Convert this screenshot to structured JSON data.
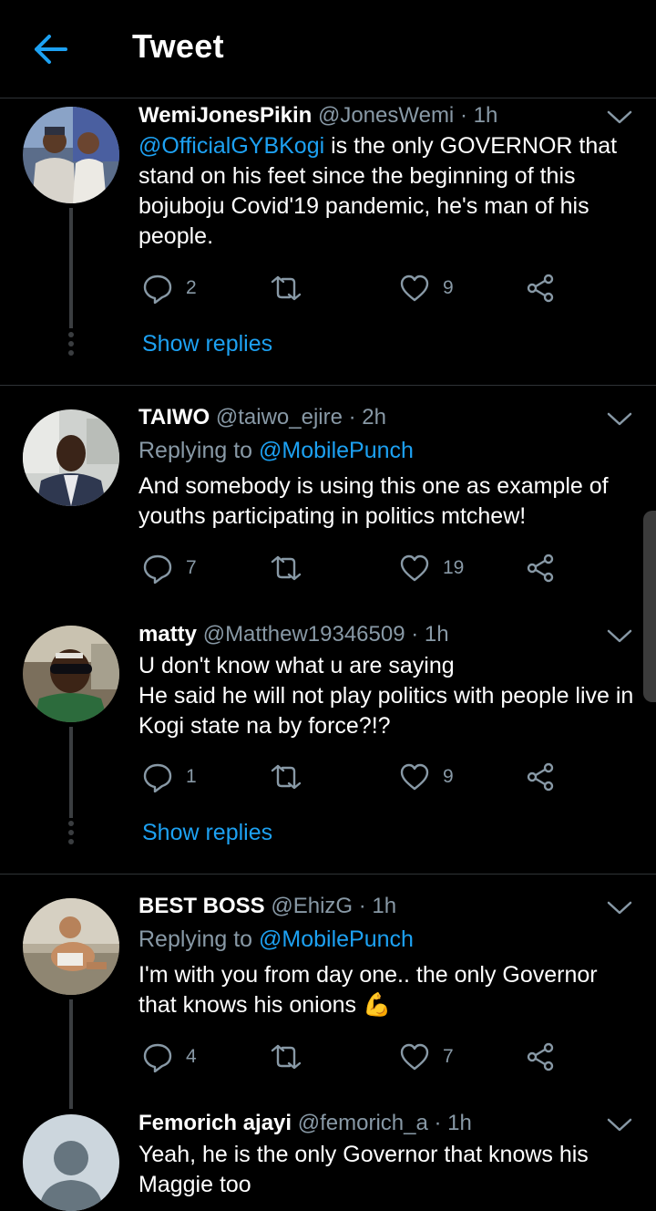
{
  "header": {
    "title": "Tweet",
    "back_icon": "arrow-left-icon"
  },
  "colors": {
    "accent": "#1da1f2",
    "secondary_text": "#8899a6",
    "background": "#000000",
    "divider": "#2f3336"
  },
  "tweets": [
    {
      "name": "WemiJonesPikin",
      "handle": "@JonesWemi",
      "time": "· 1h",
      "mention": "@OfficialGYBKogi",
      "text": " is the only GOVERNOR that stand on his feet since the beginning of this bojuboju Covid'19 pandemic, he's man of his people.",
      "replies": "2",
      "retweets": "",
      "likes": "9",
      "show_replies": "Show replies"
    },
    {
      "name": "TAIWO",
      "handle": "@taiwo_ejire",
      "time": "· 2h",
      "replying_prefix": "Replying to ",
      "replying_to": "@MobilePunch",
      "text": "And somebody is using this one as example of youths participating in politics mtchew!",
      "replies": "7",
      "retweets": "",
      "likes": "19"
    },
    {
      "name": "matty",
      "handle": "@Matthew19346509",
      "time": "· 1h",
      "text_line1": "U don't know what u are saying",
      "text_line2": "He said he will not play politics with people live in Kogi state na by force?!?",
      "replies": "1",
      "retweets": "",
      "likes": "9",
      "show_replies": "Show replies"
    },
    {
      "name": "BEST BOSS",
      "handle": "@EhizG",
      "time": "· 1h",
      "replying_prefix": "Replying to ",
      "replying_to": "@MobilePunch",
      "text": "I'm with you from day one.. the only Governor that knows his onions",
      "emoji": "💪",
      "replies": "4",
      "retweets": "",
      "likes": "7"
    },
    {
      "name": "Femorich ajayi",
      "handle": "@femorich_a",
      "time": "· 1h",
      "text": "Yeah, he is the only Governor that knows his Maggie too"
    }
  ]
}
